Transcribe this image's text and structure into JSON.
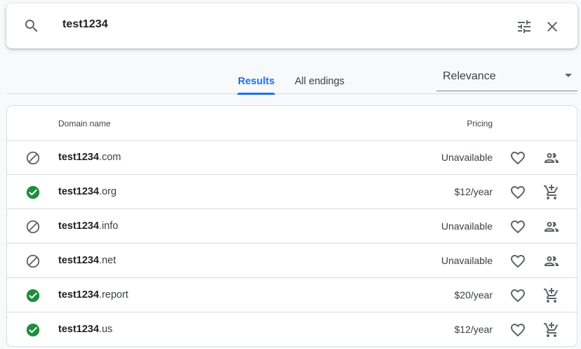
{
  "search": {
    "query": "test1234",
    "icon": "search-icon",
    "filter_icon": "tune-icon",
    "clear_icon": "close-icon"
  },
  "tabs": [
    {
      "label": "Results",
      "active": true
    },
    {
      "label": "All endings",
      "active": false
    }
  ],
  "sort": {
    "selected": "Relevance",
    "icon": "dropdown-arrow-icon"
  },
  "table": {
    "headers": {
      "domain": "Domain name",
      "pricing": "Pricing"
    },
    "rows": [
      {
        "name": "test1234",
        "tld": ".com",
        "price": "Unavailable",
        "available": false
      },
      {
        "name": "test1234",
        "tld": ".org",
        "price": "$12/year",
        "available": true
      },
      {
        "name": "test1234",
        "tld": ".info",
        "price": "Unavailable",
        "available": false
      },
      {
        "name": "test1234",
        "tld": ".net",
        "price": "Unavailable",
        "available": false
      },
      {
        "name": "test1234",
        "tld": ".report",
        "price": "$20/year",
        "available": true
      },
      {
        "name": "test1234",
        "tld": ".us",
        "price": "$12/year",
        "available": true
      }
    ]
  },
  "colors": {
    "accent": "#1a73e8",
    "available": "#1e8e3e",
    "icon": "#5f6368",
    "divider": "#dadce0"
  }
}
